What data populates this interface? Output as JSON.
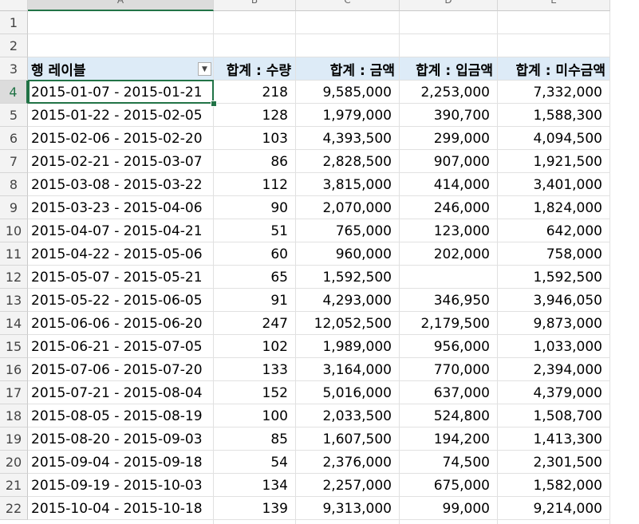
{
  "columns": [
    "A",
    "B",
    "C",
    "D",
    "E"
  ],
  "rows": [
    "1",
    "2",
    "3",
    "4",
    "5",
    "6",
    "7",
    "8",
    "9",
    "10",
    "11",
    "12",
    "13",
    "14",
    "15",
    "16",
    "17",
    "18",
    "19",
    "20",
    "21",
    "22"
  ],
  "pivot": {
    "headers": {
      "row_label": "행 레이블",
      "qty": "합계 : 수량",
      "amount": "합계 : 금액",
      "paid": "합계 : 입금액",
      "unpaid": "합계 : 미수금액"
    },
    "filter_icon": "dropdown-filter-icon",
    "data": [
      {
        "label": "2015-01-07 - 2015-01-21",
        "qty": "218",
        "amount": "9,585,000",
        "paid": "2,253,000",
        "unpaid": "7,332,000"
      },
      {
        "label": "2015-01-22 - 2015-02-05",
        "qty": "128",
        "amount": "1,979,000",
        "paid": "390,700",
        "unpaid": "1,588,300"
      },
      {
        "label": "2015-02-06 - 2015-02-20",
        "qty": "103",
        "amount": "4,393,500",
        "paid": "299,000",
        "unpaid": "4,094,500"
      },
      {
        "label": "2015-02-21 - 2015-03-07",
        "qty": "86",
        "amount": "2,828,500",
        "paid": "907,000",
        "unpaid": "1,921,500"
      },
      {
        "label": "2015-03-08 - 2015-03-22",
        "qty": "112",
        "amount": "3,815,000",
        "paid": "414,000",
        "unpaid": "3,401,000"
      },
      {
        "label": "2015-03-23 - 2015-04-06",
        "qty": "90",
        "amount": "2,070,000",
        "paid": "246,000",
        "unpaid": "1,824,000"
      },
      {
        "label": "2015-04-07 - 2015-04-21",
        "qty": "51",
        "amount": "765,000",
        "paid": "123,000",
        "unpaid": "642,000"
      },
      {
        "label": "2015-04-22 - 2015-05-06",
        "qty": "60",
        "amount": "960,000",
        "paid": "202,000",
        "unpaid": "758,000"
      },
      {
        "label": "2015-05-07 - 2015-05-21",
        "qty": "65",
        "amount": "1,592,500",
        "paid": "",
        "unpaid": "1,592,500"
      },
      {
        "label": "2015-05-22 - 2015-06-05",
        "qty": "91",
        "amount": "4,293,000",
        "paid": "346,950",
        "unpaid": "3,946,050"
      },
      {
        "label": "2015-06-06 - 2015-06-20",
        "qty": "247",
        "amount": "12,052,500",
        "paid": "2,179,500",
        "unpaid": "9,873,000"
      },
      {
        "label": "2015-06-21 - 2015-07-05",
        "qty": "102",
        "amount": "1,989,000",
        "paid": "956,000",
        "unpaid": "1,033,000"
      },
      {
        "label": "2015-07-06 - 2015-07-20",
        "qty": "133",
        "amount": "3,164,000",
        "paid": "770,000",
        "unpaid": "2,394,000"
      },
      {
        "label": "2015-07-21 - 2015-08-04",
        "qty": "152",
        "amount": "5,016,000",
        "paid": "637,000",
        "unpaid": "4,379,000"
      },
      {
        "label": "2015-08-05 - 2015-08-19",
        "qty": "100",
        "amount": "2,033,500",
        "paid": "524,800",
        "unpaid": "1,508,700"
      },
      {
        "label": "2015-08-20 - 2015-09-03",
        "qty": "85",
        "amount": "1,607,500",
        "paid": "194,200",
        "unpaid": "1,413,300"
      },
      {
        "label": "2015-09-04 - 2015-09-18",
        "qty": "54",
        "amount": "2,376,000",
        "paid": "74,500",
        "unpaid": "2,301,500"
      },
      {
        "label": "2015-09-19 - 2015-10-03",
        "qty": "134",
        "amount": "2,257,000",
        "paid": "675,000",
        "unpaid": "1,582,000"
      },
      {
        "label": "2015-10-04 - 2015-10-18",
        "qty": "139",
        "amount": "9,313,000",
        "paid": "99,000",
        "unpaid": "9,214,000"
      }
    ]
  },
  "active_cell": "A4",
  "colors": {
    "accent": "#217346",
    "header_band": "#ddebf7"
  }
}
